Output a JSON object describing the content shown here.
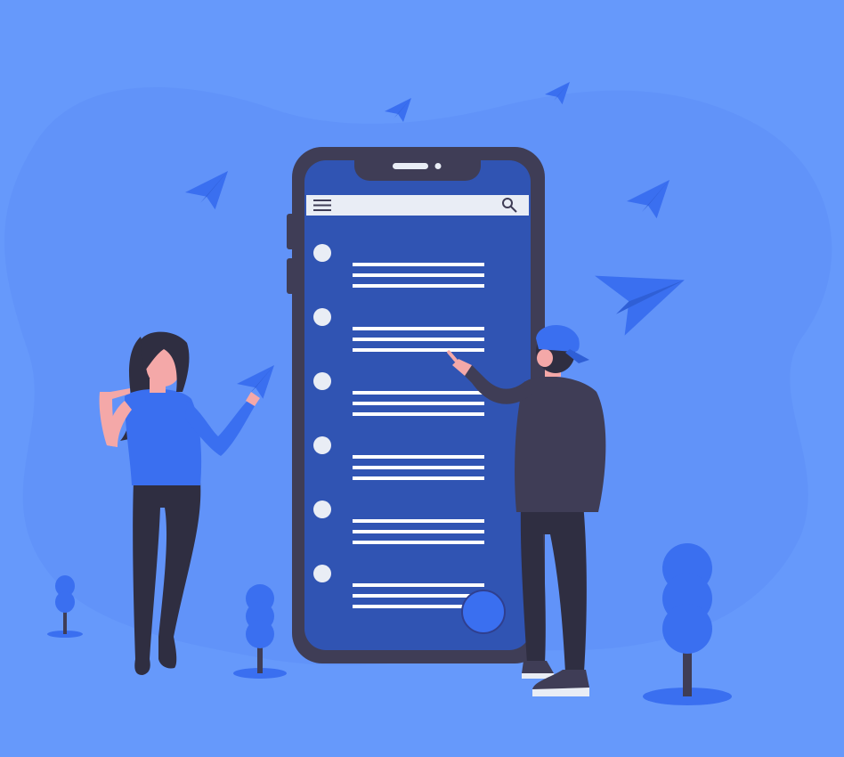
{
  "colors": {
    "background": "#6699fb",
    "blob": "#6193f9",
    "phone_frame": "#3f3d56",
    "phone_screen": "#3054b3",
    "search_bar": "#e9edf5",
    "list_line": "#ffffff",
    "accent_blue": "#3a6ff0",
    "shirt_blue": "#3a6ff0",
    "skin": "#f4a8a8",
    "hair": "#2f2e41",
    "pants": "#2f2e41",
    "hoodie": "#3f3d56",
    "tree_blue": "#3a6ff0",
    "tree_trunk": "#3f3d56"
  },
  "icons": {
    "menu": "hamburger-menu-icon",
    "search": "search-icon",
    "plane": "paper-plane-icon"
  },
  "phone": {
    "list_items": 6,
    "has_fab": true
  }
}
